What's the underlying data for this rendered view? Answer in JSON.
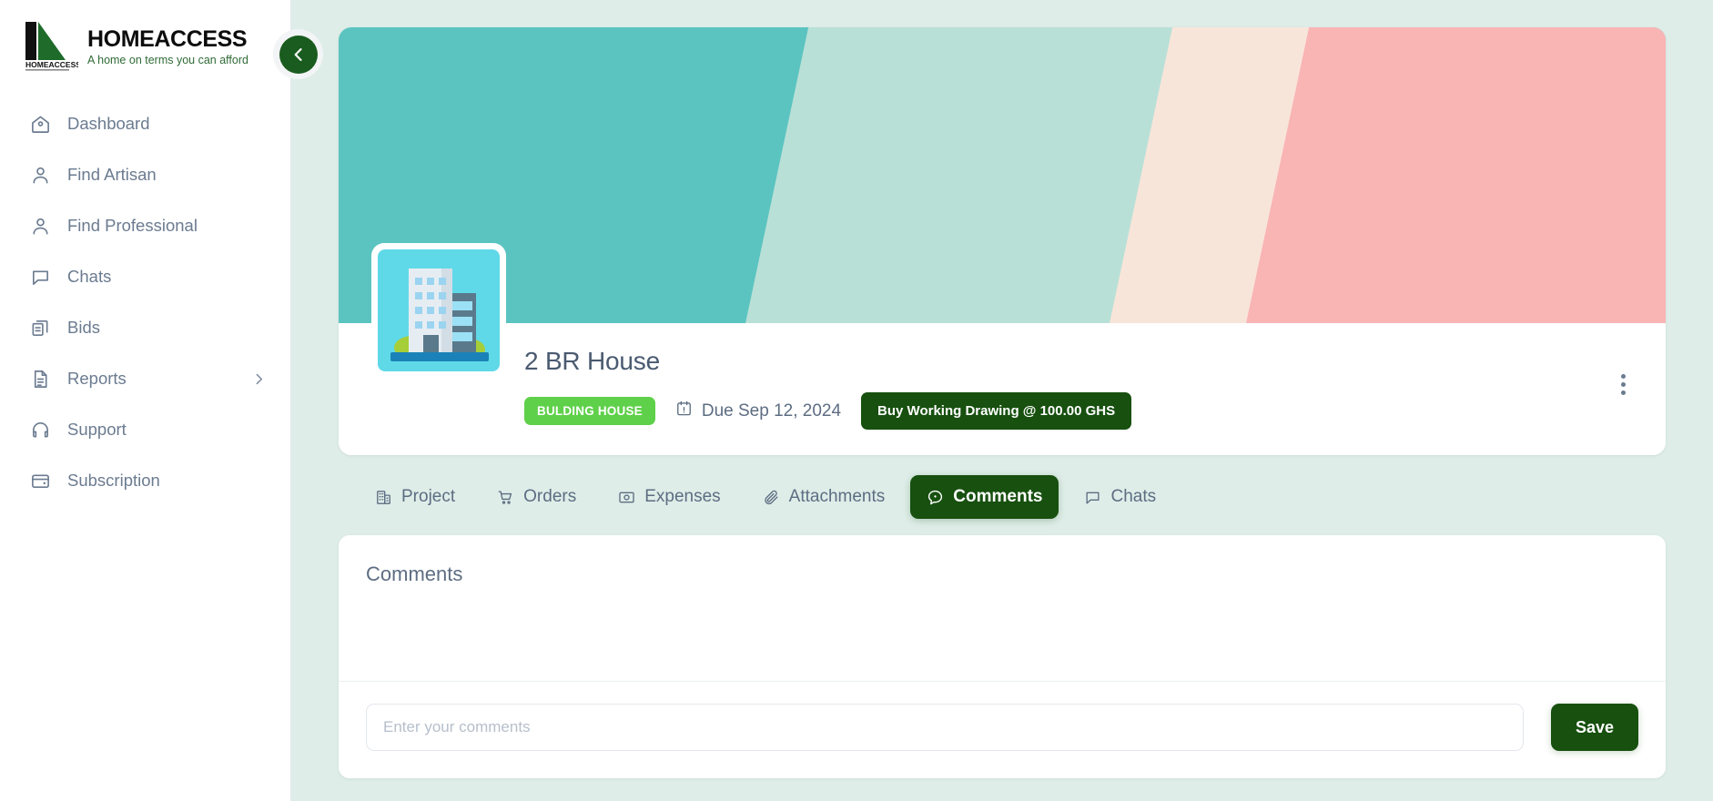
{
  "brand": {
    "name": "HOMEACCESS",
    "tagline": "A home on terms you can afford",
    "logo_wordmark": "HOMEACCESS",
    "accent_green": "#17500F",
    "badge_green": "#5FD04A"
  },
  "sidebar": {
    "collapse_icon": "chevron-left-icon",
    "items": [
      {
        "label": "Dashboard",
        "icon": "home-icon"
      },
      {
        "label": "Find Artisan",
        "icon": "user-icon"
      },
      {
        "label": "Find Professional",
        "icon": "user-icon"
      },
      {
        "label": "Chats",
        "icon": "chat-bubble-icon"
      },
      {
        "label": "Bids",
        "icon": "copy-documents-icon"
      },
      {
        "label": "Reports",
        "icon": "document-icon",
        "chevron": "chevron-right-icon"
      },
      {
        "label": "Support",
        "icon": "headset-icon"
      },
      {
        "label": "Subscription",
        "icon": "wallet-icon"
      }
    ]
  },
  "banner": {
    "stripe_colors": [
      "#5BC4C0",
      "#B9E0D7",
      "#F8E5DA",
      "#F9B4B4"
    ]
  },
  "project": {
    "thumbnail_icon": "office-building-icon",
    "title": "2 BR House",
    "category_badge": "BULDING HOUSE",
    "due_icon": "calendar-icon",
    "due_label": "Due Sep 12, 2024",
    "buy_button": "Buy Working Drawing @ 100.00 GHS",
    "menu_icon": "more-vertical-icon"
  },
  "tabs": [
    {
      "label": "Project",
      "icon": "building-icon",
      "active": false
    },
    {
      "label": "Orders",
      "icon": "cart-icon",
      "active": false
    },
    {
      "label": "Expenses",
      "icon": "money-icon",
      "active": false
    },
    {
      "label": "Attachments",
      "icon": "paperclip-icon",
      "active": false
    },
    {
      "label": "Comments",
      "icon": "comment-icon",
      "active": true
    },
    {
      "label": "Chats",
      "icon": "chat-icon",
      "active": false
    }
  ],
  "comments_panel": {
    "title": "Comments",
    "input_placeholder": "Enter your comments",
    "input_value": "",
    "save_label": "Save"
  }
}
